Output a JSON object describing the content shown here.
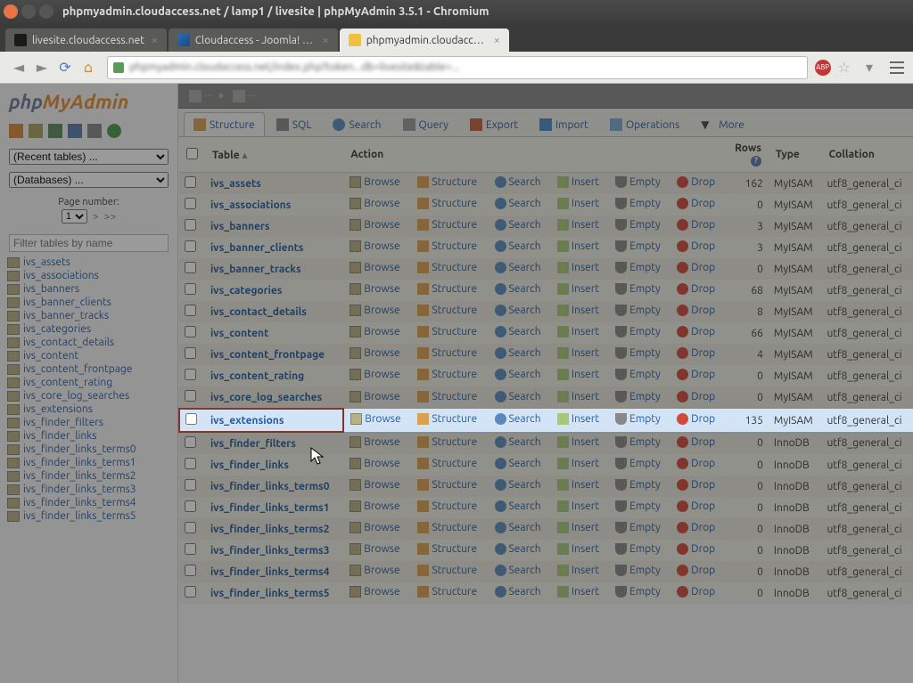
{
  "window": {
    "title": "phpmyadmin.cloudaccess.net / lamp1 / livesite | phpMyAdmin 3.5.1 - Chromium"
  },
  "tabs": [
    {
      "label": "livesite.cloudaccess.net",
      "active": false,
      "fav": "fav1"
    },
    {
      "label": "Cloudaccess - Joomla! as a...",
      "active": false,
      "fav": "fav2"
    },
    {
      "label": "phpmyadmin.cloudaccess...",
      "active": true,
      "fav": "fav3"
    }
  ],
  "sidebar": {
    "recent": "(Recent tables) ...",
    "databases": "(Databases) ...",
    "page_label": "Page number:",
    "page_value": "1",
    "filter_placeholder": "Filter tables by name",
    "tables": [
      "ivs_assets",
      "ivs_associations",
      "ivs_banners",
      "ivs_banner_clients",
      "ivs_banner_tracks",
      "ivs_categories",
      "ivs_contact_details",
      "ivs_content",
      "ivs_content_frontpage",
      "ivs_content_rating",
      "ivs_core_log_searches",
      "ivs_extensions",
      "ivs_finder_filters",
      "ivs_finder_links",
      "ivs_finder_links_terms0",
      "ivs_finder_links_terms1",
      "ivs_finder_links_terms2",
      "ivs_finder_links_terms3",
      "ivs_finder_links_terms4",
      "ivs_finder_links_terms5"
    ]
  },
  "maintabs": {
    "structure": "Structure",
    "sql": "SQL",
    "search": "Search",
    "query": "Query",
    "export": "Export",
    "import": "Import",
    "operations": "Operations",
    "more": "More"
  },
  "columns": {
    "table": "Table",
    "action": "Action",
    "rows": "Rows",
    "type": "Type",
    "collation": "Collation"
  },
  "actions": {
    "browse": "Browse",
    "structure": "Structure",
    "search": "Search",
    "insert": "Insert",
    "empty": "Empty",
    "drop": "Drop"
  },
  "rows": [
    {
      "name": "ivs_assets",
      "rows": "162",
      "type": "MyISAM",
      "coll": "utf8_general_ci"
    },
    {
      "name": "ivs_associations",
      "rows": "0",
      "type": "MyISAM",
      "coll": "utf8_general_ci"
    },
    {
      "name": "ivs_banners",
      "rows": "3",
      "type": "MyISAM",
      "coll": "utf8_general_ci"
    },
    {
      "name": "ivs_banner_clients",
      "rows": "3",
      "type": "MyISAM",
      "coll": "utf8_general_ci"
    },
    {
      "name": "ivs_banner_tracks",
      "rows": "0",
      "type": "MyISAM",
      "coll": "utf8_general_ci"
    },
    {
      "name": "ivs_categories",
      "rows": "68",
      "type": "MyISAM",
      "coll": "utf8_general_ci"
    },
    {
      "name": "ivs_contact_details",
      "rows": "8",
      "type": "MyISAM",
      "coll": "utf8_general_ci"
    },
    {
      "name": "ivs_content",
      "rows": "66",
      "type": "MyISAM",
      "coll": "utf8_general_ci"
    },
    {
      "name": "ivs_content_frontpage",
      "rows": "4",
      "type": "MyISAM",
      "coll": "utf8_general_ci"
    },
    {
      "name": "ivs_content_rating",
      "rows": "0",
      "type": "MyISAM",
      "coll": "utf8_general_ci"
    },
    {
      "name": "ivs_core_log_searches",
      "rows": "0",
      "type": "MyISAM",
      "coll": "utf8_general_ci"
    },
    {
      "name": "ivs_extensions",
      "rows": "135",
      "type": "MyISAM",
      "coll": "utf8_general_ci",
      "highlight": true
    },
    {
      "name": "ivs_finder_filters",
      "rows": "0",
      "type": "InnoDB",
      "coll": "utf8_general_ci"
    },
    {
      "name": "ivs_finder_links",
      "rows": "0",
      "type": "InnoDB",
      "coll": "utf8_general_ci"
    },
    {
      "name": "ivs_finder_links_terms0",
      "rows": "0",
      "type": "InnoDB",
      "coll": "utf8_general_ci"
    },
    {
      "name": "ivs_finder_links_terms1",
      "rows": "0",
      "type": "InnoDB",
      "coll": "utf8_general_ci"
    },
    {
      "name": "ivs_finder_links_terms2",
      "rows": "0",
      "type": "InnoDB",
      "coll": "utf8_general_ci"
    },
    {
      "name": "ivs_finder_links_terms3",
      "rows": "0",
      "type": "InnoDB",
      "coll": "utf8_general_ci"
    },
    {
      "name": "ivs_finder_links_terms4",
      "rows": "0",
      "type": "InnoDB",
      "coll": "utf8_general_ci"
    },
    {
      "name": "ivs_finder_links_terms5",
      "rows": "0",
      "type": "InnoDB",
      "coll": "utf8_general_ci"
    }
  ]
}
